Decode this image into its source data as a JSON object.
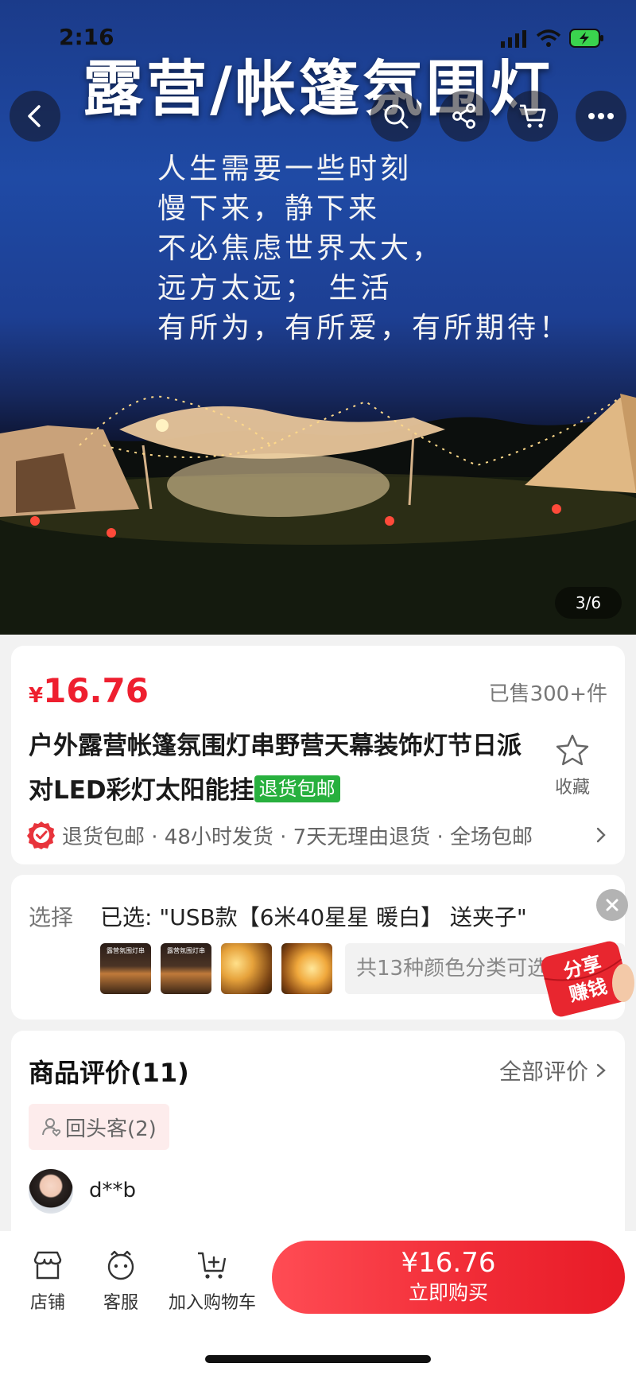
{
  "status_bar": {
    "time": "2:16"
  },
  "hero": {
    "title": "露营/帐篷氛围灯",
    "poem": [
      "人生需要一些时刻",
      "慢下来，静下来",
      "不必焦虑世界太大，",
      "远方太远；  生活",
      "有所为，有所爱，有所期待！"
    ],
    "image_counter": "3/6",
    "nav_icons": [
      "back-icon",
      "search-icon",
      "share-icon",
      "cart-icon",
      "more-icon"
    ]
  },
  "product": {
    "currency": "¥",
    "price": "16.76",
    "sold": "已售300+件",
    "title": "户外露营帐篷氛围灯串野营天幕装饰灯节日派对LED彩灯太阳能挂",
    "badge": "退货包邮",
    "favorite_label": "收藏",
    "services": "退货包邮 · 48小时发货 · 7天无理由退货 · 全场包邮"
  },
  "selection": {
    "label": "选择",
    "selected": "已选:  \"USB款【6米40星星 暖白】 送夹子\"",
    "thumb_caption": "露营氛围灯串",
    "color_count": "共13种颜色分类可选"
  },
  "share_badge": {
    "line1": "分享",
    "line2": "赚钱"
  },
  "reviews": {
    "title": "商品评价(11)",
    "all_label": "全部评价",
    "tag": "回头客(2)",
    "reviewer": "d**b"
  },
  "bottom_bar": {
    "store": "店铺",
    "service": "客服",
    "add_cart": "加入购物车",
    "buy_price": "¥16.76",
    "buy_label": "立即购买"
  },
  "colors": {
    "price_red": "#ee1f2f",
    "badge_green": "#28b03e",
    "buy_red": "#f02a35"
  }
}
